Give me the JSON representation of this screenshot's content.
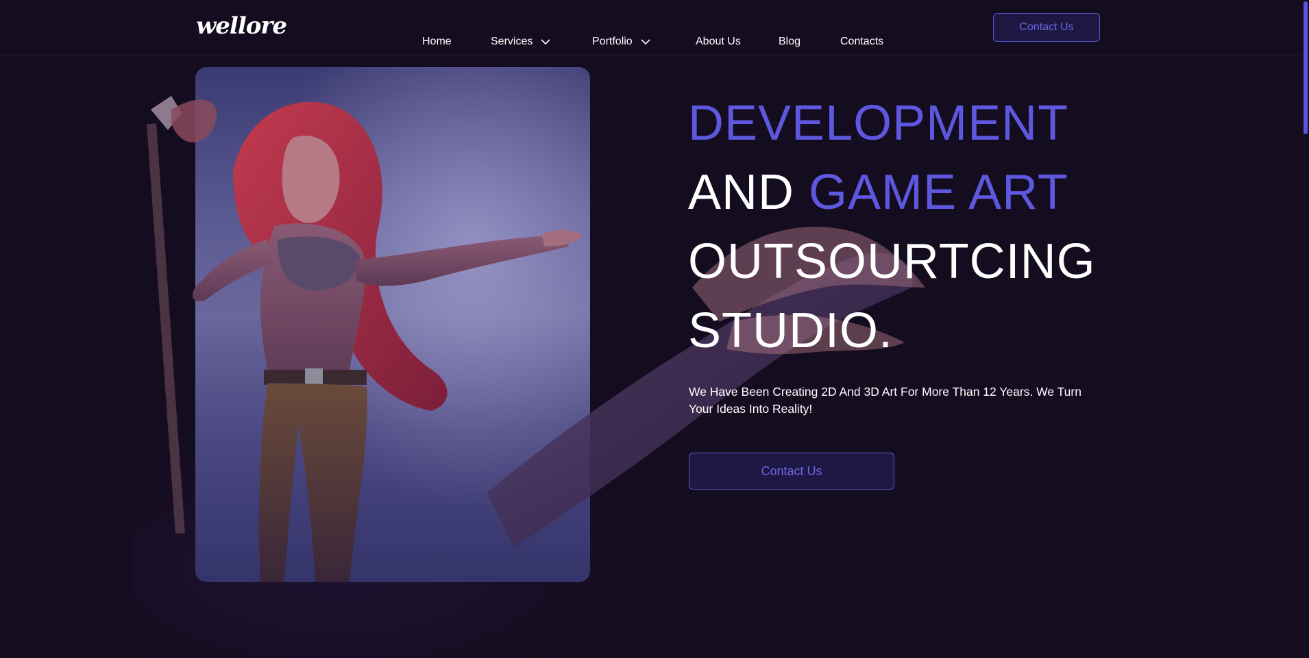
{
  "brand": {
    "logo_text": "wellore"
  },
  "nav": {
    "items": [
      {
        "label": "Home",
        "has_dropdown": false
      },
      {
        "label": "Services",
        "has_dropdown": true
      },
      {
        "label": "Portfolio",
        "has_dropdown": true
      },
      {
        "label": "About Us",
        "has_dropdown": false
      },
      {
        "label": "Blog",
        "has_dropdown": false
      },
      {
        "label": "Contacts",
        "has_dropdown": false
      }
    ],
    "cta_label": "Contact Us"
  },
  "hero": {
    "headline": {
      "line1": "DEVELOPMENT",
      "line2_plain": "AND ",
      "line2_accent": "GAME ART",
      "line3": "OUTSOURTCING",
      "line4": "STUDIO."
    },
    "subtitle": "We Have Been Creating 2D And 3D Art For More Than 12 Years. We Turn Your Ideas Into Reality!",
    "cta_label": "Contact Us"
  },
  "icons": {
    "dropdown": "chevron-down-icon"
  },
  "colors": {
    "background": "#140c1f",
    "accent": "#5d58df",
    "button_border": "#5a55d6",
    "button_bg": "#1e1741",
    "text": "#ffffff"
  }
}
